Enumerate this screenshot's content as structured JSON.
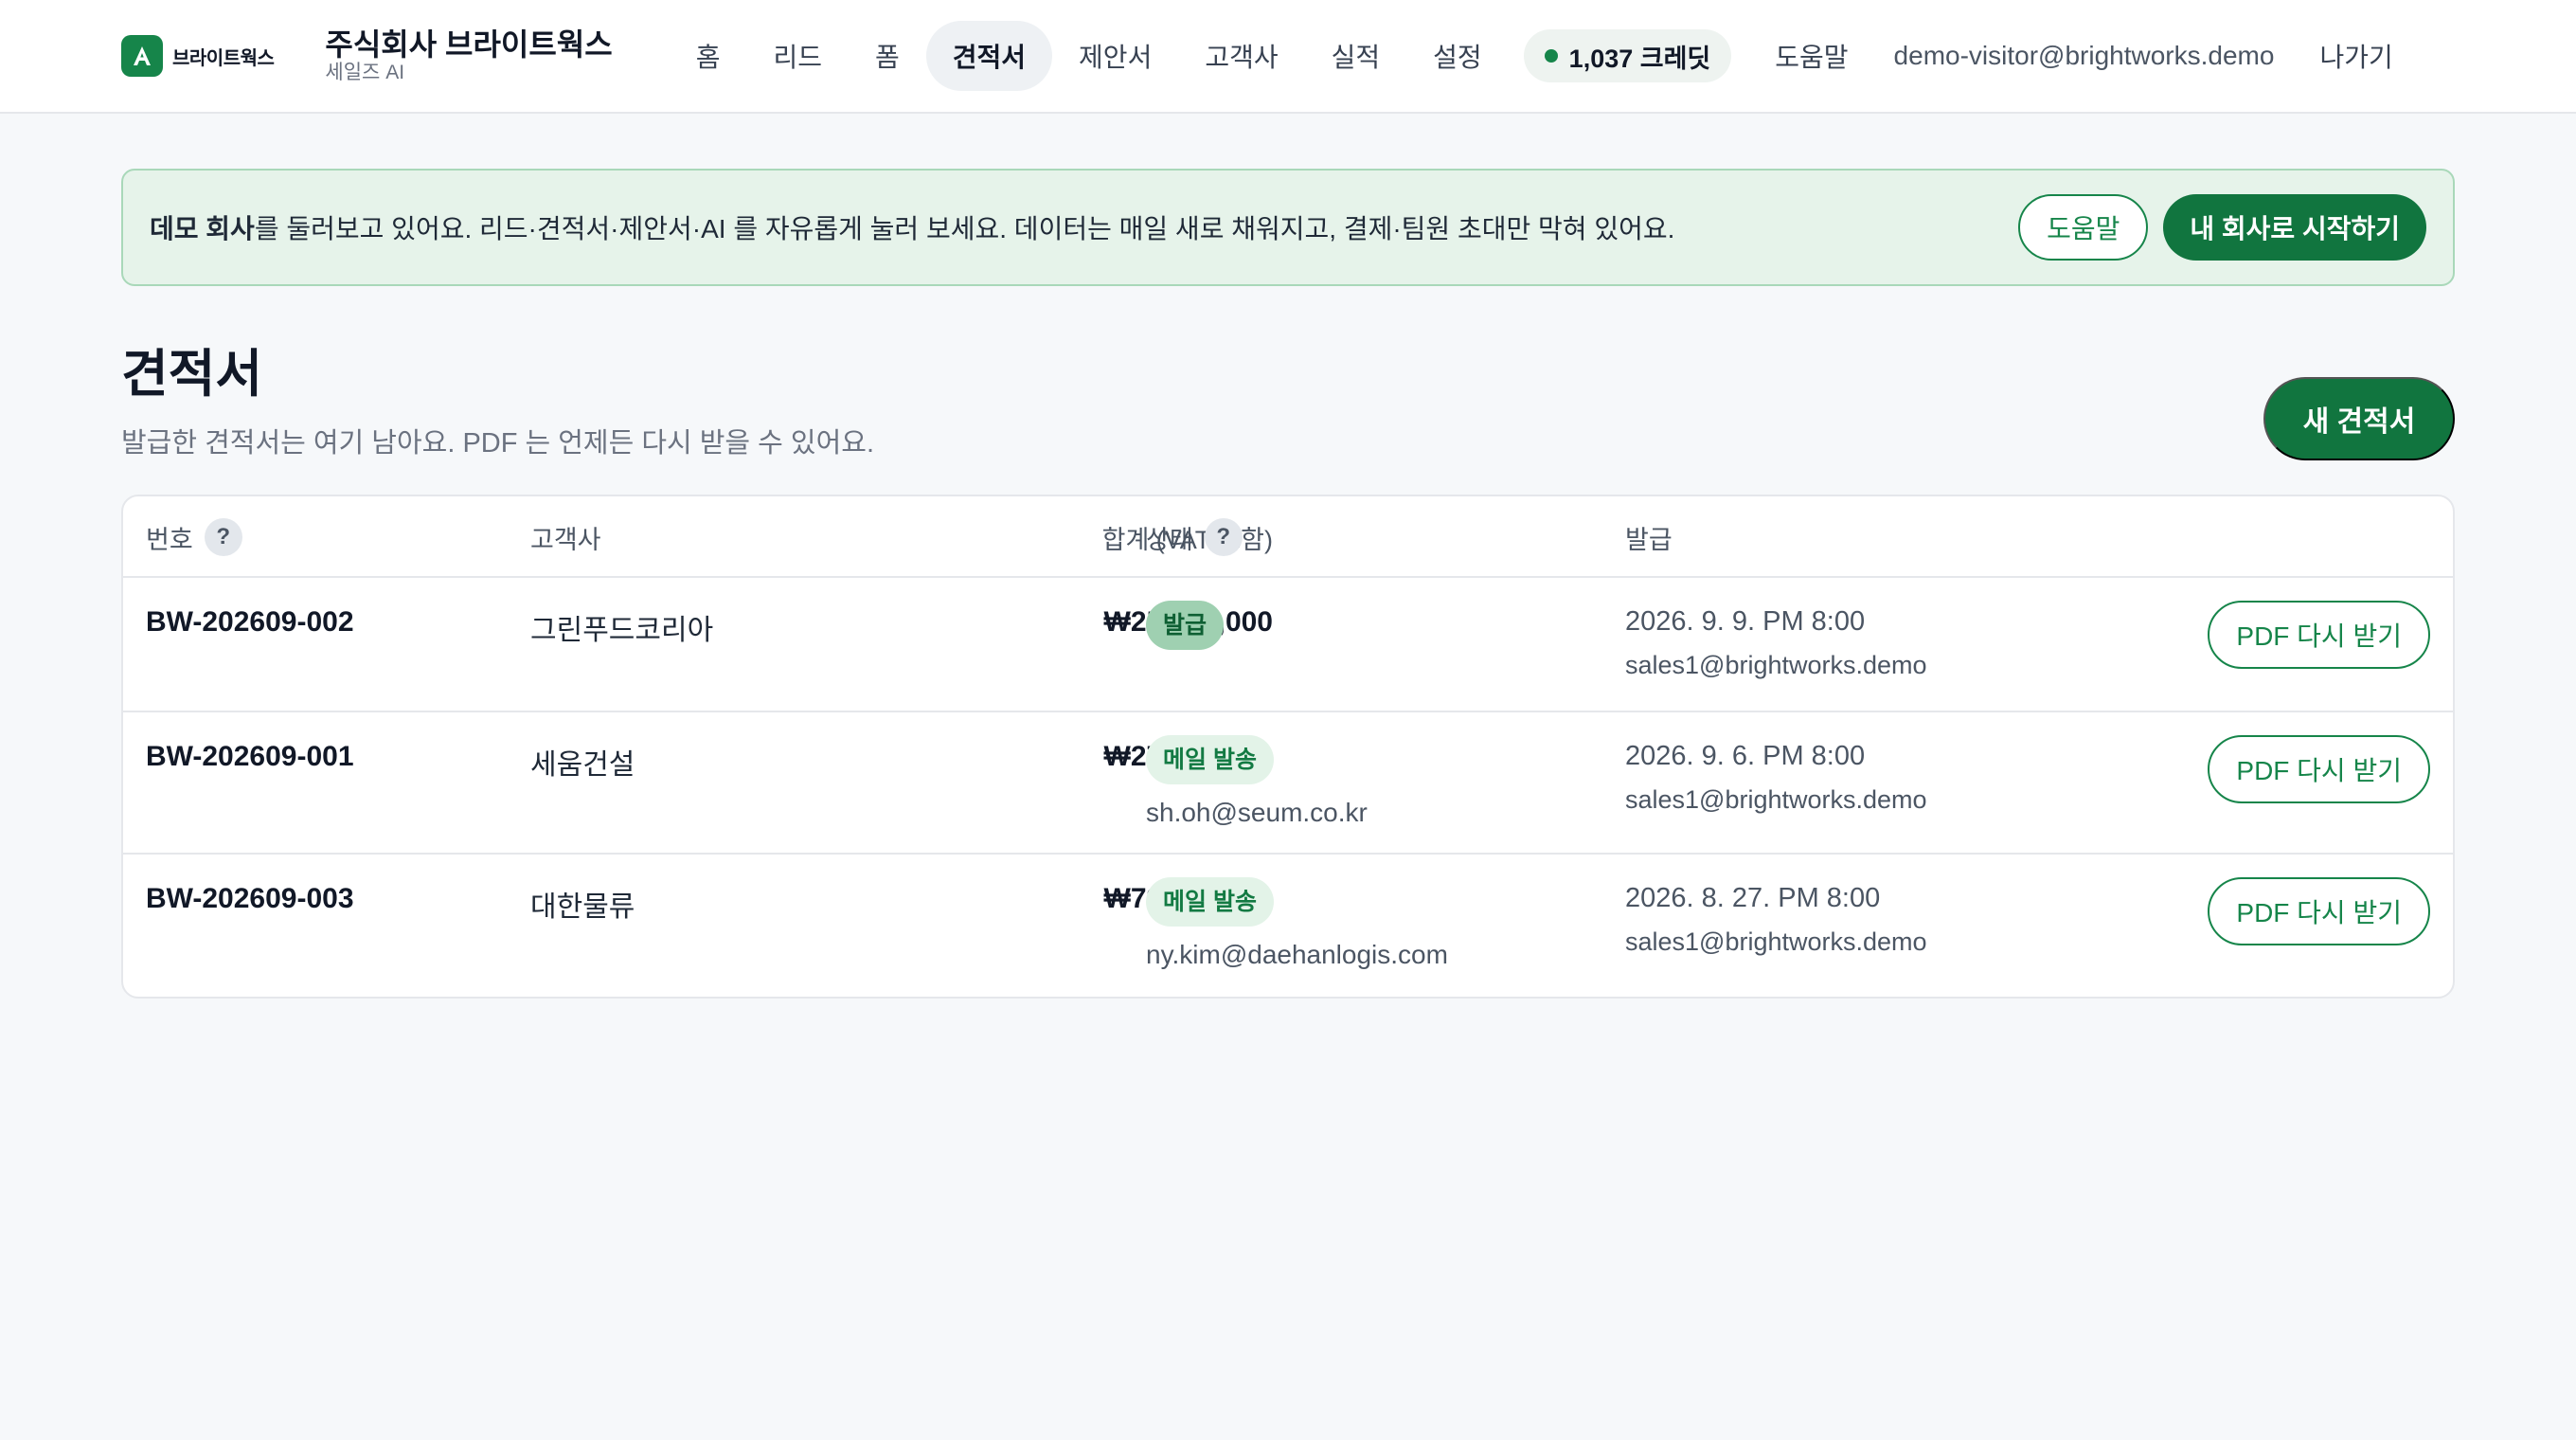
{
  "header": {
    "logo_text": "브라이트웍스",
    "logo_icon": "logo-a-icon",
    "company_name": "주식회사 브라이트웍스",
    "company_sub": "세일즈 AI",
    "nav": [
      "홈",
      "리드",
      "폼",
      "견적서",
      "제안서",
      "고객사",
      "실적",
      "설정"
    ],
    "active_nav": "견적서",
    "credits": "1,037 크레딧",
    "help": "도움말",
    "email": "demo-visitor@brightworks.demo",
    "logout": "나가기"
  },
  "banner": {
    "bold": "데모 회사",
    "text": "를 둘러보고 있어요. 리드·견적서·제안서·AI 를 자유롭게 눌러 보세요. 데이터는 매일 새로 채워지고, 결제·팀원 초대만 막혀 있어요.",
    "help_button": "도움말",
    "start_button": "내 회사로 시작하기"
  },
  "page": {
    "title": "견적서",
    "description": "발급한 견적서는 여기 남아요. PDF 는 언제든 다시 받을 수 있어요.",
    "new_button": "새 견적서"
  },
  "table": {
    "columns": {
      "number": "번호",
      "customer": "고객사",
      "total": "합계 (VAT 포함)",
      "status": "상태",
      "issued": "발급"
    },
    "help_mark": "?",
    "rows": [
      {
        "number": "BW-202609-002",
        "customer": "그린푸드코리아",
        "total": "₩25,674,000",
        "status": "발급",
        "status_kind": "issued",
        "recipient": "",
        "date": "2026. 9. 9. PM 8:00",
        "issuer": "sales1@brightworks.demo",
        "pdf": "PDF 다시 받기"
      },
      {
        "number": "BW-202609-001",
        "customer": "세움건설",
        "total": "₩27,786,000",
        "status": "메일 발송",
        "status_kind": "mailed",
        "recipient": "sh.oh@seum.co.kr",
        "date": "2026. 9. 6. PM 8:00",
        "issuer": "sales1@brightworks.demo",
        "pdf": "PDF 다시 받기"
      },
      {
        "number": "BW-202609-003",
        "customer": "대한물류",
        "total": "₩79,530,000",
        "status": "메일 발송",
        "status_kind": "mailed",
        "recipient": "ny.kim@daehanlogis.com",
        "date": "2026. 8. 27. PM 8:00",
        "issuer": "sales1@brightworks.demo",
        "pdf": "PDF 다시 받기"
      }
    ]
  },
  "colors": {
    "brand": "#16854a",
    "brand_dark": "#11753f",
    "banner_bg": "#e6f3ea",
    "page_bg": "#f6f8fa"
  }
}
